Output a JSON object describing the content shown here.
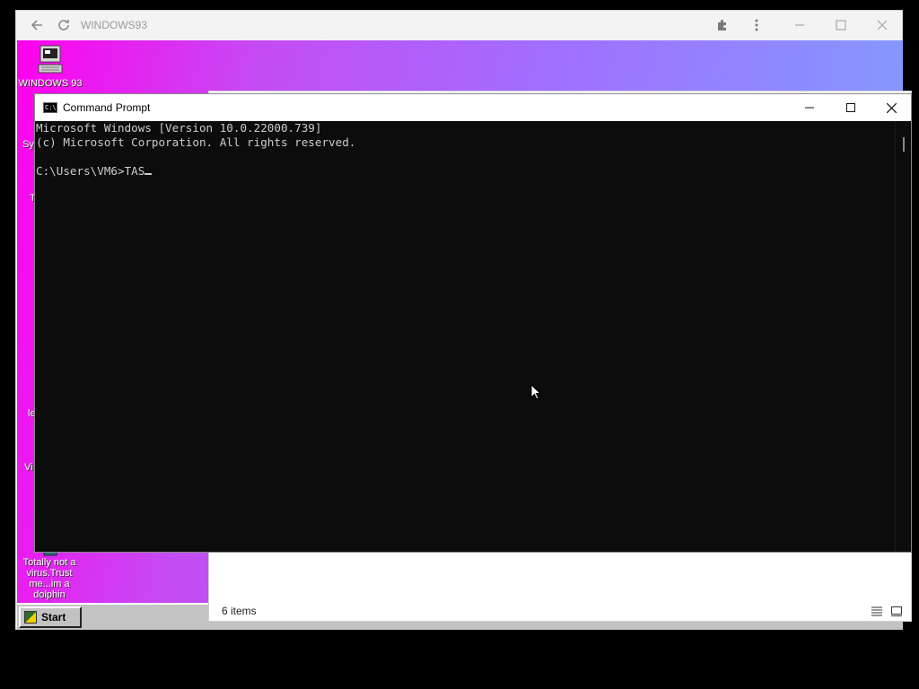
{
  "browser": {
    "title": "WINDOWS93",
    "back_icon": "back-arrow-icon",
    "reload_icon": "reload-icon",
    "extensions_icon": "puzzle-icon",
    "menu_icon": "kebab-menu-icon"
  },
  "desktop": {
    "icons": [
      {
        "label": "WINDOWS 93",
        "icon": "computer-icon"
      },
      {
        "label": "Totally not a virus.Trust me...im a dolphin",
        "icon": "dolphin-icon"
      }
    ],
    "partial_labels": [
      "Sy",
      "T",
      "le",
      "Vi"
    ],
    "taskbar": {
      "start_label": "Start"
    }
  },
  "explorer": {
    "status_text": "6 items"
  },
  "cmd": {
    "title": "Command Prompt",
    "icon_text": "C:\\",
    "lines": [
      "Microsoft Windows [Version 10.0.22000.739]",
      "(c) Microsoft Corporation. All rights reserved.",
      "",
      "C:\\Users\\VM6>TAS"
    ],
    "minimize_icon": "minimize-icon",
    "maximize_icon": "maximize-icon",
    "close_icon": "close-icon"
  },
  "colors": {
    "desktop_gradient_start": "#ff00ee",
    "desktop_gradient_end": "#7ea2ff",
    "console_bg": "#0c0c0c",
    "console_fg": "#cccccc"
  }
}
